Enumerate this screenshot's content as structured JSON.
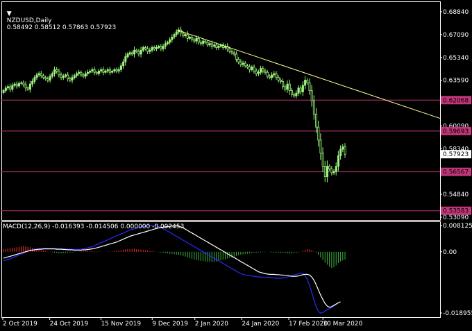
{
  "header": {
    "symbol": "NZDUSD,Daily",
    "ohlc": "0.58492 0.58512 0.57863 0.57923"
  },
  "macd_header": "MACD(12,26,9) -0.016393 -0.014506 0.000000 -0.002453",
  "colors": {
    "background": "#000000",
    "grid": "#404040",
    "bull_candle": "#9cf57c",
    "bear_candle": "#000000",
    "trendline": "#ffff99",
    "level_line": "#c2367a",
    "level_label_bg": "#c2367a",
    "price_label_bg": "#ffffff",
    "macd_signal": "#ffffff",
    "macd_line": "#2a2aff",
    "hist_pos": "#ff3030",
    "hist_neg": "#3cb43c",
    "axis_text": "#ffffff"
  },
  "chart_data": [
    {
      "type": "candlestick",
      "title": "NZDUSD,Daily",
      "ylim": [
        0.5309,
        0.6884
      ],
      "y_ticks": [
        "0.68840",
        "0.67090",
        "0.65340",
        "0.63590",
        "0.60090",
        "0.58340",
        "0.54840",
        "0.53090"
      ],
      "x_ticks": [
        "2 Oct 2019",
        "24 Oct 2019",
        "15 Nov 2019",
        "9 Dec 2019",
        "2 Jan 2020",
        "24 Jan 2020",
        "17 Feb 2020",
        "10 Mar 2020"
      ],
      "current_price": "0.57923",
      "levels": [
        {
          "label": "0.62068",
          "value": 0.62068
        },
        {
          "label": "0.59693",
          "value": 0.59693
        },
        {
          "label": "0.56567",
          "value": 0.56567
        },
        {
          "label": "0.53583",
          "value": 0.53583
        }
      ],
      "trendline": {
        "from": [
          0.0,
          0.6746
        ],
        "to": [
          1.0,
          0.6067
        ],
        "x_start_index": 78
      },
      "closes": [
        0.628,
        0.63,
        0.631,
        0.629,
        0.632,
        0.633,
        0.6315,
        0.6335,
        0.634,
        0.6325,
        0.63,
        0.629,
        0.633,
        0.635,
        0.638,
        0.64,
        0.641,
        0.6395,
        0.638,
        0.637,
        0.636,
        0.639,
        0.641,
        0.644,
        0.643,
        0.64,
        0.638,
        0.639,
        0.64,
        0.637,
        0.636,
        0.638,
        0.6395,
        0.641,
        0.642,
        0.64,
        0.639,
        0.641,
        0.642,
        0.643,
        0.644,
        0.642,
        0.641,
        0.643,
        0.644,
        0.642,
        0.643,
        0.644,
        0.642,
        0.643,
        0.644,
        0.643,
        0.644,
        0.647,
        0.65,
        0.654,
        0.656,
        0.657,
        0.656,
        0.659,
        0.658,
        0.656,
        0.659,
        0.661,
        0.66,
        0.658,
        0.659,
        0.661,
        0.66,
        0.661,
        0.662,
        0.66,
        0.662,
        0.664,
        0.665,
        0.667,
        0.669,
        0.671,
        0.673,
        0.6745,
        0.672,
        0.67,
        0.671,
        0.668,
        0.669,
        0.667,
        0.666,
        0.668,
        0.665,
        0.664,
        0.666,
        0.665,
        0.663,
        0.664,
        0.662,
        0.663,
        0.661,
        0.662,
        0.663,
        0.661,
        0.662,
        0.66,
        0.658,
        0.657,
        0.656,
        0.652,
        0.65,
        0.648,
        0.649,
        0.647,
        0.646,
        0.644,
        0.646,
        0.643,
        0.641,
        0.642,
        0.645,
        0.643,
        0.642,
        0.639,
        0.638,
        0.64,
        0.641,
        0.638,
        0.636,
        0.635,
        0.631,
        0.629,
        0.633,
        0.628,
        0.625,
        0.624,
        0.626,
        0.63,
        0.627,
        0.632,
        0.636,
        0.634,
        0.628,
        0.62,
        0.61,
        0.6,
        0.59,
        0.58,
        0.57,
        0.562,
        0.57,
        0.568,
        0.565,
        0.566,
        0.57,
        0.578,
        0.583,
        0.5849,
        0.5792
      ]
    },
    {
      "type": "macd",
      "title": "MACD(12,26,9)",
      "ylim": [
        -0.018955,
        0.008125
      ],
      "y_ticks": [
        "0.008125",
        "0.00",
        "-0.018955"
      ],
      "histogram": [
        0.0008,
        0.0009,
        0.001,
        0.0011,
        0.0012,
        0.0013,
        0.0014,
        0.0015,
        0.0016,
        0.0018,
        0.0017,
        0.0015,
        0.0014,
        0.0012,
        0.001,
        0.0008,
        0.0006,
        0.0005,
        0.0004,
        0.0002,
        0.0001,
        -0.0001,
        -0.0002,
        -0.0003,
        -0.0004,
        -0.0005,
        -0.0005,
        -0.0004,
        -0.0004,
        -0.0003,
        -0.0003,
        -0.0002,
        -0.0001,
        0.0,
        0.0001,
        0.0002,
        0.0002,
        0.0003,
        0.0003,
        0.0003,
        0.0002,
        0.0002,
        0.0001,
        0.0001,
        0.0001,
        0.0,
        0.0,
        0.0001,
        0.0001,
        0.0001,
        0.0002,
        0.0003,
        0.0004,
        0.0005,
        0.0006,
        0.0007,
        0.0008,
        0.0008,
        0.0009,
        0.0009,
        0.0008,
        0.0007,
        0.0007,
        0.0006,
        0.0005,
        0.0004,
        0.0003,
        0.0002,
        0.0001,
        0.0,
        -0.0001,
        -0.0002,
        -0.0003,
        -0.0004,
        -0.0005,
        -0.0006,
        -0.0007,
        -0.0008,
        -0.0009,
        -0.001,
        -0.0011,
        -0.0013,
        -0.0015,
        -0.0018,
        -0.002,
        -0.0022,
        -0.0024,
        -0.0026,
        -0.0027,
        -0.0028,
        -0.0029,
        -0.003,
        -0.0031,
        -0.0031,
        -0.0032,
        -0.0031,
        -0.003,
        -0.0029,
        -0.0027,
        -0.0025,
        -0.0023,
        -0.0021,
        -0.0019,
        -0.0017,
        -0.0015,
        -0.0013,
        -0.0011,
        -0.0009,
        -0.0008,
        -0.0007,
        -0.0006,
        -0.0005,
        -0.0004,
        -0.0003,
        -0.0003,
        -0.0002,
        -0.0002,
        -0.0001,
        -0.0001,
        0.0,
        -0.0001,
        -0.0002,
        -0.0002,
        -0.0003,
        -0.0003,
        -0.0004,
        -0.0004,
        -0.0005,
        -0.0005,
        -0.0006,
        -0.0005,
        -0.0004,
        -0.0003,
        -0.0002,
        0.0,
        0.0003,
        0.0006,
        0.0008,
        0.0007,
        0.0005,
        0.0002,
        -0.0003,
        -0.001,
        -0.0018,
        -0.0026,
        -0.0034,
        -0.004,
        -0.0046,
        -0.005,
        -0.0048,
        -0.0042,
        -0.0035,
        -0.003,
        -0.0027,
        -0.0024
      ],
      "signal": [
        -0.002,
        -0.0018,
        -0.0016,
        -0.0014,
        -0.0012,
        -0.001,
        -0.0008,
        -0.0006,
        -0.0004,
        -0.0002,
        0.0,
        0.0002,
        0.0004,
        0.0005,
        0.0006,
        0.0007,
        0.0008,
        0.0008,
        0.0009,
        0.0009,
        0.0009,
        0.0009,
        0.0009,
        0.0009,
        0.0008,
        0.0008,
        0.0008,
        0.0007,
        0.0007,
        0.0006,
        0.0006,
        0.0006,
        0.0005,
        0.0005,
        0.0005,
        0.0005,
        0.0006,
        0.0006,
        0.0007,
        0.0008,
        0.0009,
        0.001,
        0.0012,
        0.0014,
        0.0016,
        0.0018,
        0.002,
        0.0022,
        0.0024,
        0.0026,
        0.0028,
        0.003,
        0.0033,
        0.0036,
        0.0039,
        0.0042,
        0.0045,
        0.0048,
        0.005,
        0.0052,
        0.0054,
        0.0056,
        0.0058,
        0.006,
        0.0062,
        0.0064,
        0.0066,
        0.0068,
        0.007,
        0.0072,
        0.0074,
        0.0075,
        0.0076,
        0.0077,
        0.0078,
        0.0079,
        0.008,
        0.008,
        0.008,
        0.0079,
        0.0077,
        0.0074,
        0.007,
        0.0066,
        0.0062,
        0.0058,
        0.0054,
        0.005,
        0.0046,
        0.0042,
        0.0038,
        0.0034,
        0.003,
        0.0026,
        0.0022,
        0.0018,
        0.0014,
        0.001,
        0.0006,
        0.0002,
        -0.0002,
        -0.0006,
        -0.001,
        -0.0014,
        -0.0018,
        -0.0022,
        -0.0026,
        -0.003,
        -0.0034,
        -0.0038,
        -0.0042,
        -0.0046,
        -0.005,
        -0.0054,
        -0.0058,
        -0.0062,
        -0.0064,
        -0.0066,
        -0.0068,
        -0.0069,
        -0.007,
        -0.007,
        -0.007,
        -0.0071,
        -0.0071,
        -0.0072,
        -0.0072,
        -0.0073,
        -0.0074,
        -0.0075,
        -0.0076,
        -0.0076,
        -0.0076,
        -0.0075,
        -0.0073,
        -0.0071,
        -0.007,
        -0.007,
        -0.0072,
        -0.0078,
        -0.0088,
        -0.0102,
        -0.0118,
        -0.0134,
        -0.0148,
        -0.016,
        -0.0168,
        -0.0172,
        -0.017,
        -0.0166,
        -0.0162,
        -0.0158,
        -0.0155
      ],
      "macd": [
        -0.0028,
        -0.0026,
        -0.0024,
        -0.0022,
        -0.0019,
        -0.0016,
        -0.0013,
        -0.001,
        -0.0007,
        -0.0004,
        -0.0001,
        0.0002,
        0.0004,
        0.0006,
        0.0007,
        0.0008,
        0.0009,
        0.001,
        0.001,
        0.0011,
        0.001,
        0.001,
        0.001,
        0.001,
        0.001,
        0.0009,
        0.0009,
        0.0009,
        0.0008,
        0.0008,
        0.0008,
        0.0007,
        0.0007,
        0.0007,
        0.0007,
        0.0008,
        0.0009,
        0.001,
        0.0012,
        0.0014,
        0.0016,
        0.0019,
        0.0022,
        0.0025,
        0.0028,
        0.0031,
        0.0034,
        0.0037,
        0.004,
        0.0043,
        0.0046,
        0.0049,
        0.0052,
        0.0055,
        0.0058,
        0.0061,
        0.0064,
        0.0067,
        0.0069,
        0.0071,
        0.0073,
        0.0075,
        0.0077,
        0.0078,
        0.0079,
        0.008,
        0.0081,
        0.0081,
        0.0081,
        0.008,
        0.0078,
        0.0075,
        0.0072,
        0.0068,
        0.0064,
        0.006,
        0.0056,
        0.0052,
        0.0048,
        0.0044,
        0.004,
        0.0036,
        0.0032,
        0.0028,
        0.0024,
        0.002,
        0.0016,
        0.0012,
        0.0008,
        0.0004,
        0.0,
        -0.0004,
        -0.0008,
        -0.0012,
        -0.0016,
        -0.002,
        -0.0024,
        -0.0028,
        -0.0032,
        -0.0036,
        -0.004,
        -0.0044,
        -0.0048,
        -0.0052,
        -0.0056,
        -0.006,
        -0.0064,
        -0.0067,
        -0.007,
        -0.0072,
        -0.0073,
        -0.0074,
        -0.0075,
        -0.0076,
        -0.0077,
        -0.0078,
        -0.0078,
        -0.0079,
        -0.0079,
        -0.008,
        -0.008,
        -0.0081,
        -0.0081,
        -0.0082,
        -0.0082,
        -0.0082,
        -0.0081,
        -0.008,
        -0.0078,
        -0.0076,
        -0.0074,
        -0.0072,
        -0.007,
        -0.0068,
        -0.0066,
        -0.0068,
        -0.0074,
        -0.0086,
        -0.0104,
        -0.0126,
        -0.015,
        -0.017,
        -0.0185,
        -0.019,
        -0.0188,
        -0.0184,
        -0.018,
        -0.0176,
        -0.0172,
        -0.0168,
        -0.0164
      ]
    }
  ]
}
